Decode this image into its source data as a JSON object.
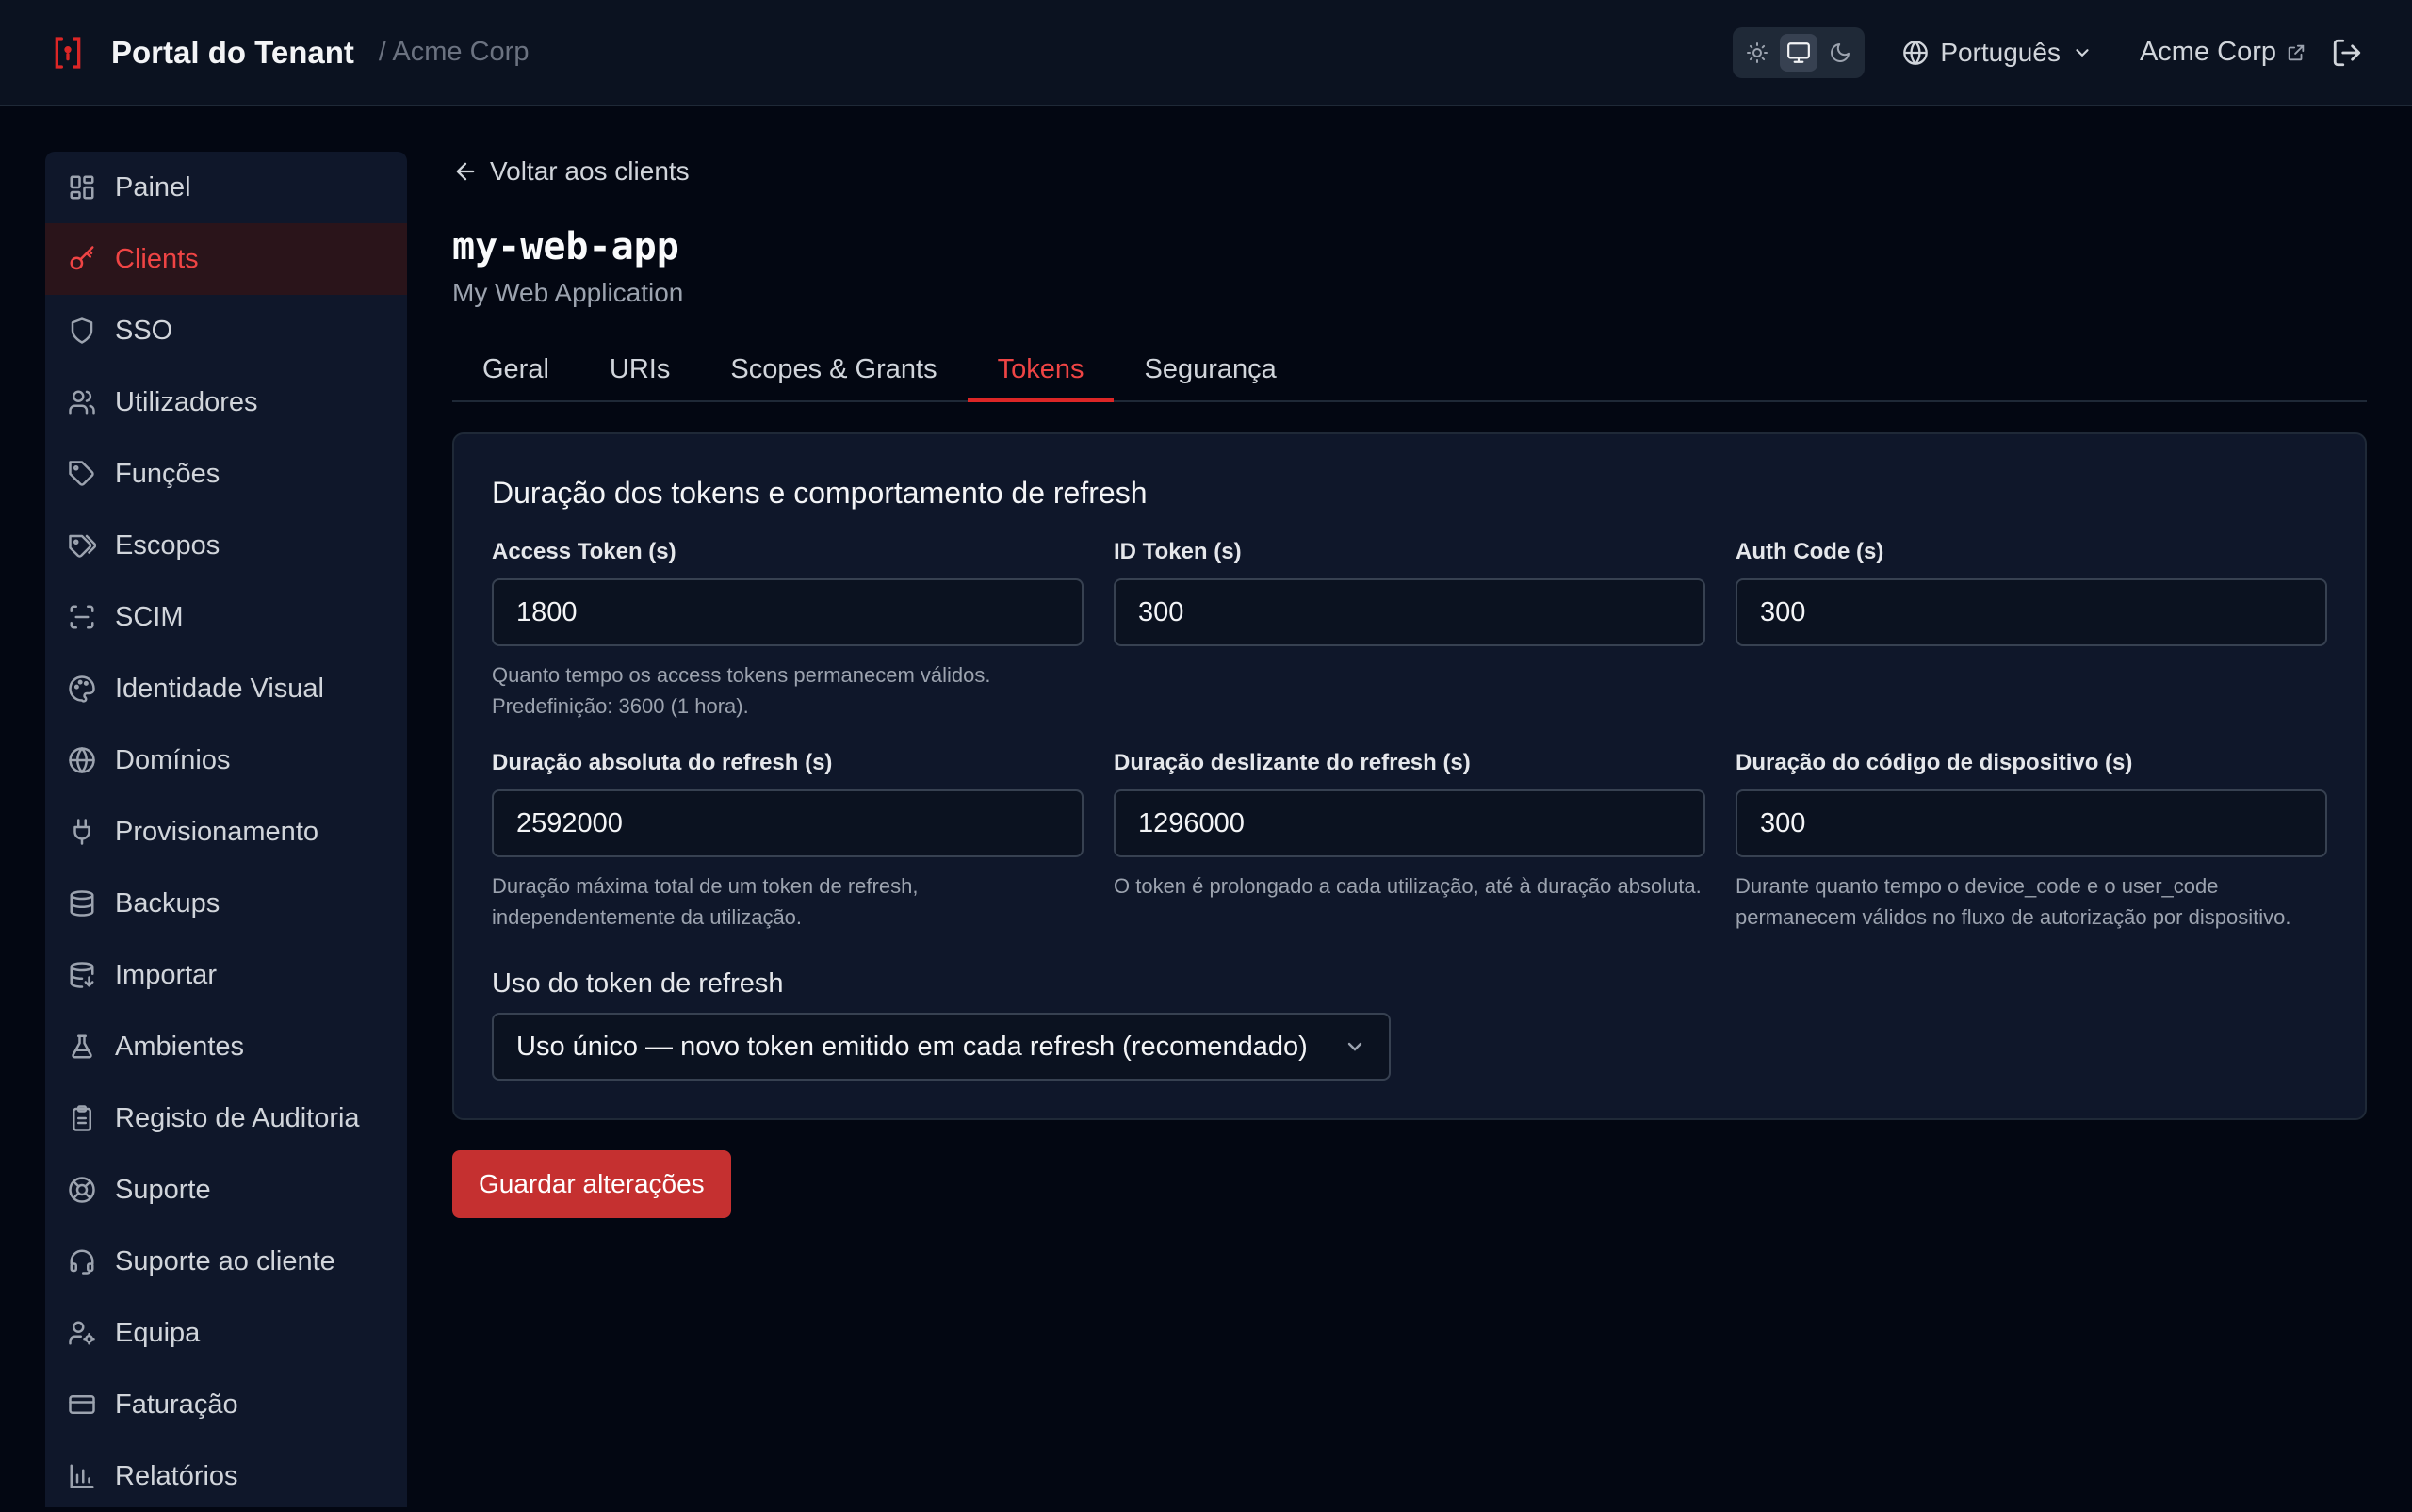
{
  "header": {
    "title": "Portal do Tenant",
    "breadcrumb": "/ Acme Corp",
    "theme_options": [
      "sun-icon",
      "monitor-icon",
      "moon-icon"
    ],
    "theme_selected": "monitor",
    "language": "Português",
    "tenant_name": "Acme Corp"
  },
  "sidebar": {
    "items": [
      {
        "label": "Painel",
        "icon": "dashboard-icon"
      },
      {
        "label": "Clients",
        "icon": "key-icon",
        "active": true
      },
      {
        "label": "SSO",
        "icon": "shield-icon"
      },
      {
        "label": "Utilizadores",
        "icon": "users-icon"
      },
      {
        "label": "Funções",
        "icon": "tag-icon"
      },
      {
        "label": "Escopos",
        "icon": "tags-icon"
      },
      {
        "label": "SCIM",
        "icon": "scan-icon"
      },
      {
        "label": "Identidade Visual",
        "icon": "palette-icon"
      },
      {
        "label": "Domínios",
        "icon": "globe-icon"
      },
      {
        "label": "Provisionamento",
        "icon": "plug-icon"
      },
      {
        "label": "Backups",
        "icon": "database-icon"
      },
      {
        "label": "Importar",
        "icon": "database-import-icon"
      },
      {
        "label": "Ambientes",
        "icon": "flask-icon"
      },
      {
        "label": "Registo de Auditoria",
        "icon": "clipboard-icon"
      },
      {
        "label": "Suporte",
        "icon": "lifebuoy-icon"
      },
      {
        "label": "Suporte ao cliente",
        "icon": "headset-icon"
      },
      {
        "label": "Equipa",
        "icon": "user-cog-icon"
      },
      {
        "label": "Faturação",
        "icon": "credit-card-icon"
      },
      {
        "label": "Relatórios",
        "icon": "bar-chart-icon"
      }
    ]
  },
  "main": {
    "back_label": "Voltar aos clients",
    "client_id": "my-web-app",
    "client_name": "My Web Application",
    "tabs": [
      {
        "label": "Geral"
      },
      {
        "label": "URIs"
      },
      {
        "label": "Scopes & Grants"
      },
      {
        "label": "Tokens",
        "active": true
      },
      {
        "label": "Segurança"
      }
    ],
    "card": {
      "title": "Duração dos tokens e comportamento de refresh",
      "fields": [
        {
          "label": "Access Token (s)",
          "value": "1800",
          "help": "Quanto tempo os access tokens permanecem válidos. Predefinição: 3600 (1 hora)."
        },
        {
          "label": "ID Token (s)",
          "value": "300",
          "help": ""
        },
        {
          "label": "Auth Code (s)",
          "value": "300",
          "help": ""
        },
        {
          "label": "Duração absoluta do refresh (s)",
          "value": "2592000",
          "help": "Duração máxima total de um token de refresh, independentemente da utilização."
        },
        {
          "label": "Duração deslizante do refresh (s)",
          "value": "1296000",
          "help": "O token é prolongado a cada utilização, até à duração absoluta."
        },
        {
          "label": "Duração do código de dispositivo (s)",
          "value": "300",
          "help": "Durante quanto tempo o device_code e o user_code permanecem válidos no fluxo de autorização por dispositivo."
        }
      ],
      "refresh_usage_label": "Uso do token de refresh",
      "refresh_usage_value": "Uso único — novo token emitido em cada refresh (recomendado)"
    },
    "save_label": "Guardar alterações"
  },
  "colors": {
    "accent": "#dc2626",
    "background": "#030712",
    "panel": "#0f172a"
  }
}
